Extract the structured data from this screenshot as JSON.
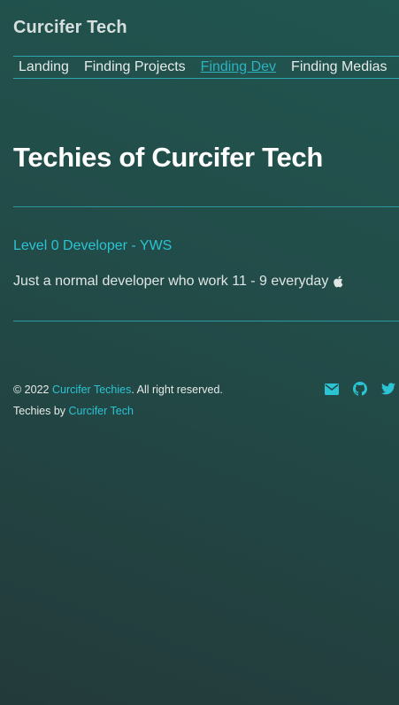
{
  "header": {
    "site_title": "Curcifer Tech"
  },
  "nav": {
    "items": [
      {
        "label": "Landing",
        "active": false
      },
      {
        "label": "Finding Projects",
        "active": false
      },
      {
        "label": "Finding Dev",
        "active": true
      },
      {
        "label": "Finding Medias",
        "active": false
      }
    ]
  },
  "main": {
    "heading": "Techies of Curcifer Tech",
    "techies": [
      {
        "name": "Level 0 Developer - YWS",
        "bio": "Just a normal developer who work 11 - 9 everyday",
        "bio_icon": "apple-icon"
      }
    ]
  },
  "footer": {
    "copyright_prefix": "© 2022 ",
    "copyright_link": "Curcifer Techies",
    "copyright_suffix": ". All right reserved.",
    "credit_prefix": "Techies by ",
    "credit_link": "Curcifer Tech",
    "social_icons": [
      "envelope-icon",
      "github-icon",
      "twitter-icon"
    ]
  },
  "colors": {
    "accent": "#2bc4d4",
    "divider": "#2b98a2",
    "background_start": "#233a3a",
    "background_end": "#21554f"
  }
}
